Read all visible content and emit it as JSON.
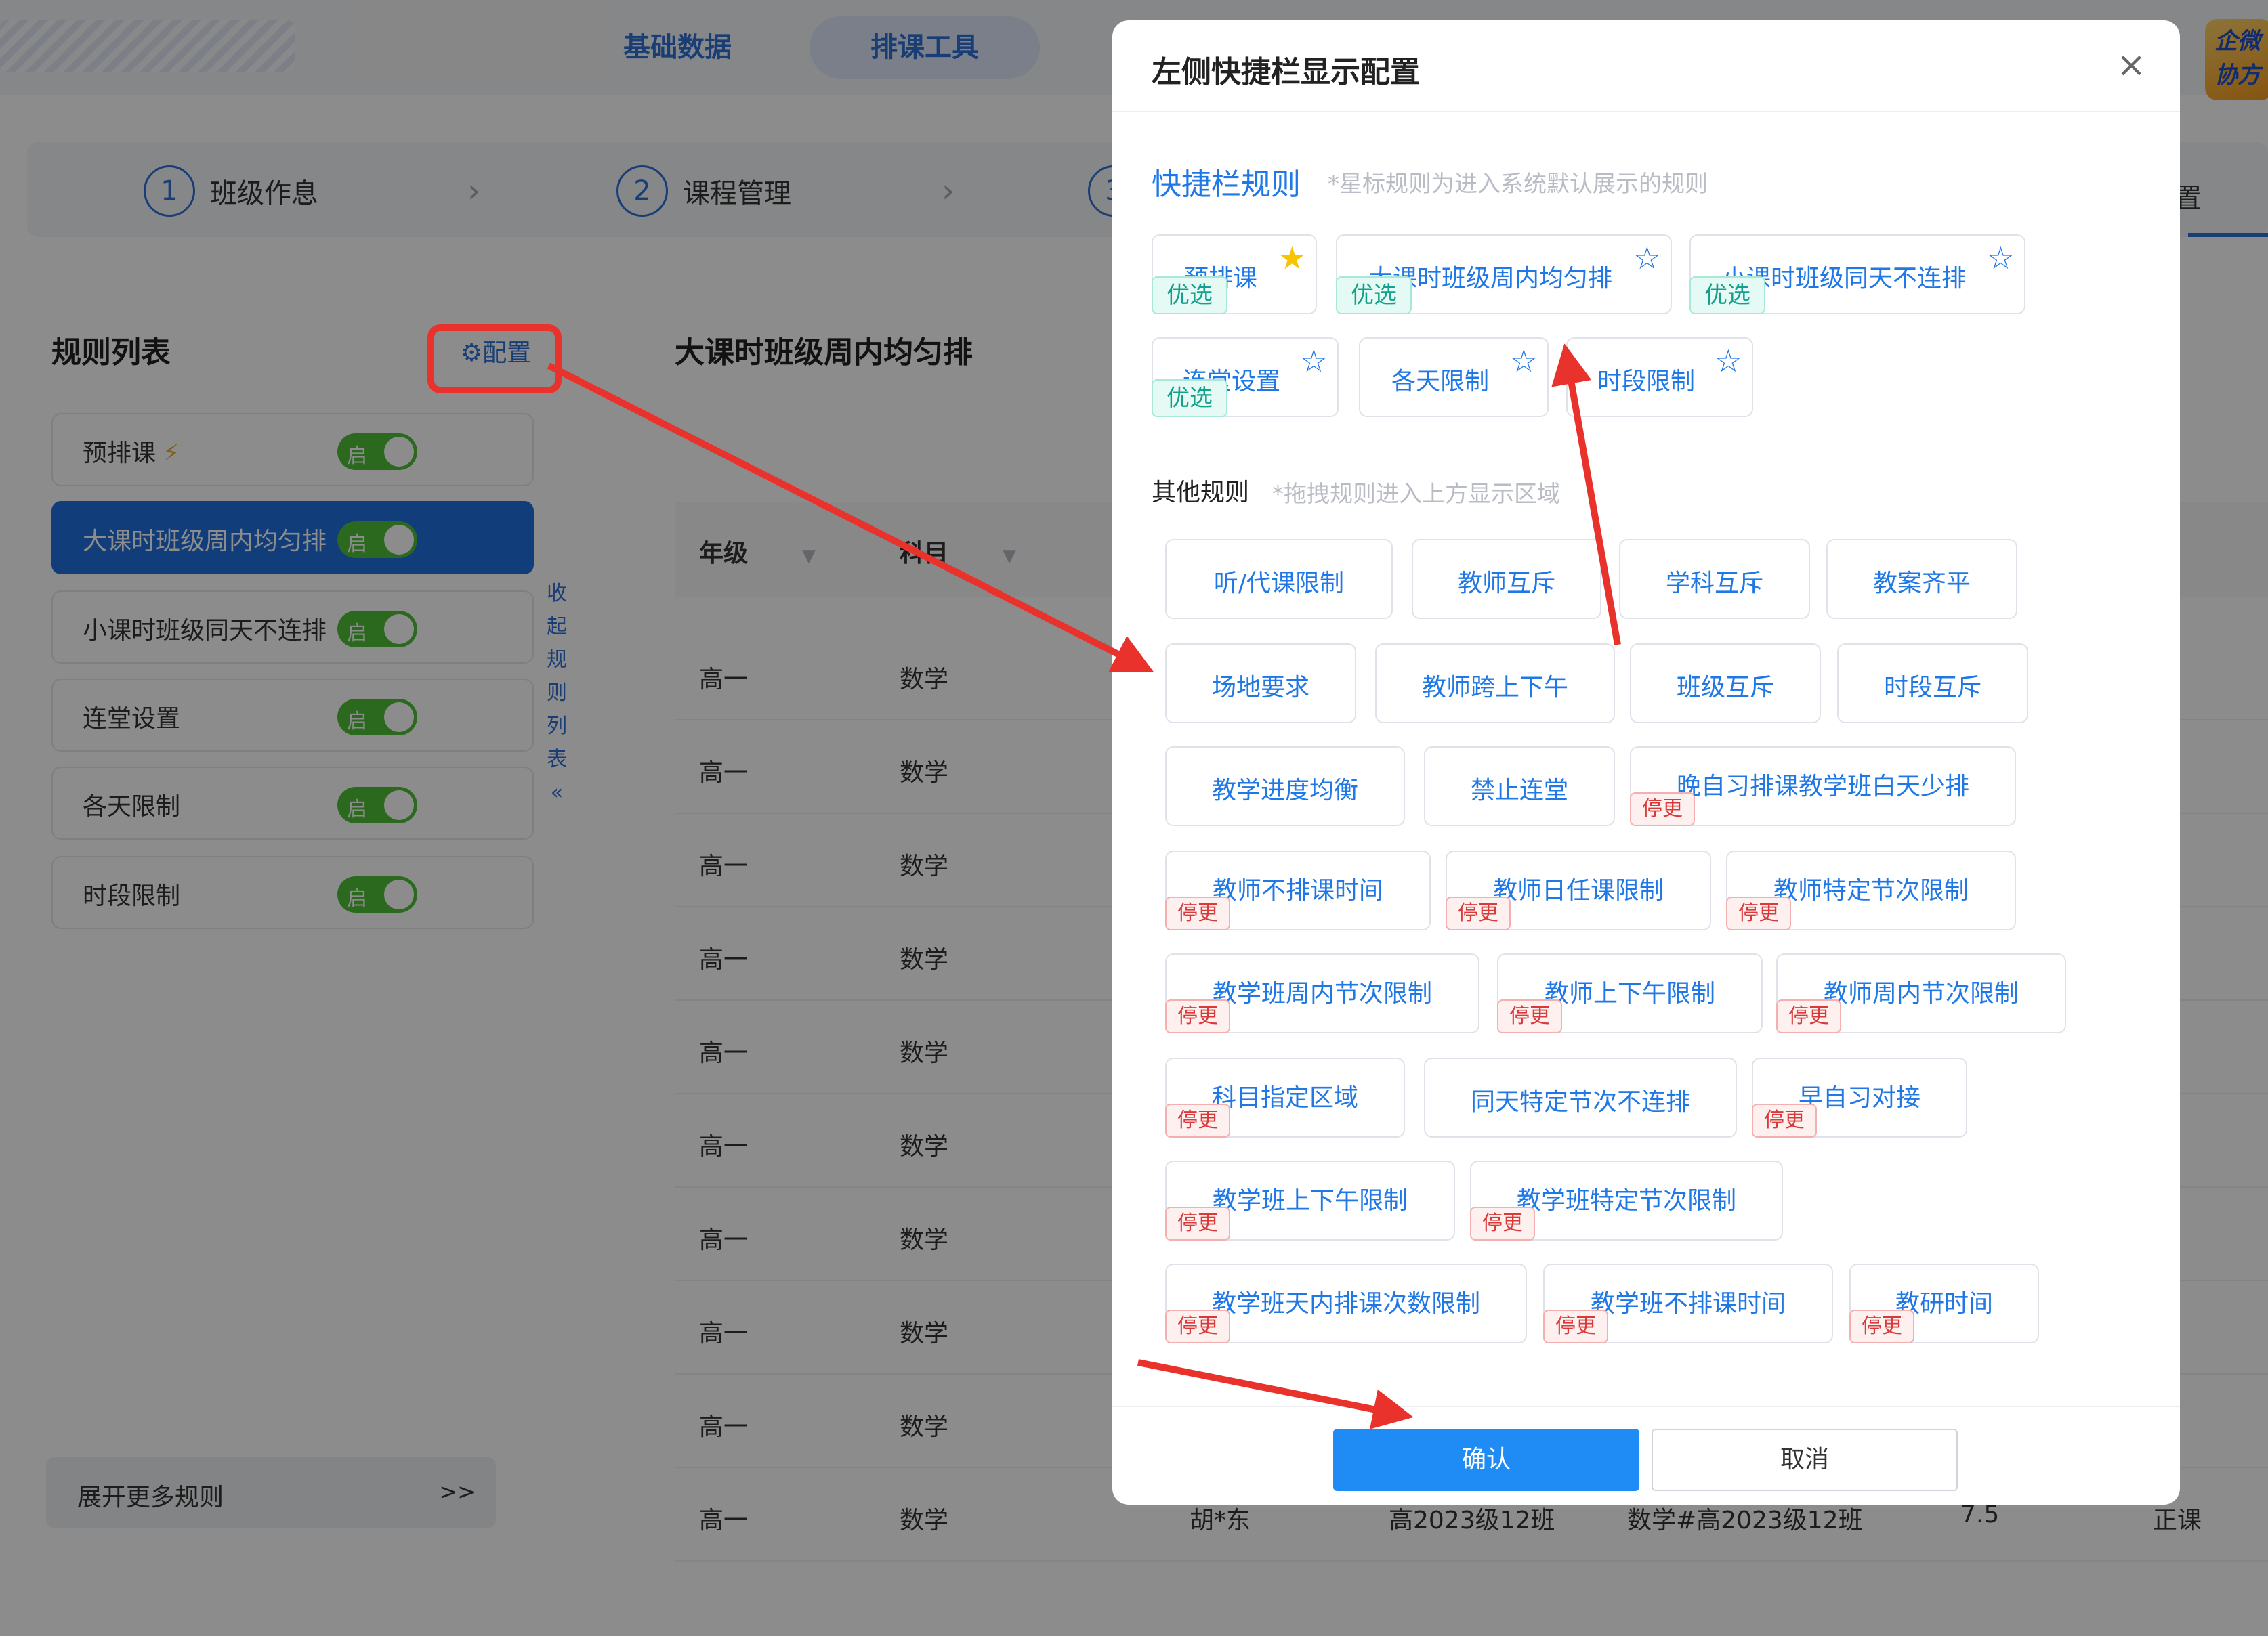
{
  "header": {
    "tabs": [
      {
        "label": "基础数据"
      },
      {
        "label": "排课工具"
      }
    ],
    "brand_logo_text": "企微协方"
  },
  "steps": [
    {
      "num": "1",
      "label": "班级作息"
    },
    {
      "num": "2",
      "label": "课程管理"
    },
    {
      "num": "3",
      "label": ""
    }
  ],
  "steps_right_label": "置",
  "left_panel": {
    "title": "规则列表",
    "config_label": "配置",
    "rules": [
      {
        "label": "预排课",
        "switch": "启",
        "bolt": "⚡"
      },
      {
        "label": "大课时班级周内均匀排",
        "switch": "启",
        "active": true
      },
      {
        "label": "小课时班级同天不连排",
        "switch": "启"
      },
      {
        "label": "连堂设置",
        "switch": "启"
      },
      {
        "label": "各天限制",
        "switch": "启"
      },
      {
        "label": "时段限制",
        "switch": "启"
      }
    ],
    "collapse_text": "收起规则列表",
    "collapse_icon": "«",
    "more_label": "展开更多规则",
    "more_arrow": ">>"
  },
  "main": {
    "title": "大课时班级周内均匀排",
    "columns": [
      "年级",
      "科目"
    ],
    "rows": [
      {
        "grade": "高一",
        "subject": "数学"
      },
      {
        "grade": "高一",
        "subject": "数学"
      },
      {
        "grade": "高一",
        "subject": "数学"
      },
      {
        "grade": "高一",
        "subject": "数学"
      },
      {
        "grade": "高一",
        "subject": "数学"
      },
      {
        "grade": "高一",
        "subject": "数学"
      },
      {
        "grade": "高一",
        "subject": "数学"
      },
      {
        "grade": "高一",
        "subject": "数学"
      },
      {
        "grade": "高一",
        "subject": "数学"
      },
      {
        "grade": "高一",
        "subject": "数学",
        "teacher": "胡*东",
        "class": "高2023级12班",
        "course": "数学#高2023级12班",
        "hours": "7.5",
        "type": "正课"
      }
    ]
  },
  "modal": {
    "title": "左侧快捷栏显示配置",
    "close_icon": "×",
    "quick_title": "快捷栏规则",
    "quick_hint": "*星标规则为进入系统默认展示的规则",
    "quick_rules": [
      {
        "label": "预排课",
        "star": true,
        "tag": "优选"
      },
      {
        "label": "大课时班级周内均匀排",
        "star": false,
        "tag": "优选"
      },
      {
        "label": "小课时班级同天不连排",
        "star": false,
        "tag": "优选"
      },
      {
        "label": "连堂设置",
        "star": false,
        "tag": "优选"
      },
      {
        "label": "各天限制",
        "star": false
      },
      {
        "label": "时段限制",
        "star": false
      }
    ],
    "other_title": "其他规则",
    "other_hint": "*拖拽规则进入上方显示区域",
    "other_rules": [
      {
        "label": "听/代课限制"
      },
      {
        "label": "教师互斥"
      },
      {
        "label": "学科互斥"
      },
      {
        "label": "教案齐平"
      },
      {
        "label": "场地要求"
      },
      {
        "label": "教师跨上下午"
      },
      {
        "label": "班级互斥"
      },
      {
        "label": "时段互斥"
      },
      {
        "label": "教学进度均衡"
      },
      {
        "label": "禁止连堂"
      },
      {
        "label": "晚自习排课教学班白天少排",
        "tag": "停更"
      },
      {
        "label": "教师不排课时间",
        "tag": "停更"
      },
      {
        "label": "教师日任课限制",
        "tag": "停更"
      },
      {
        "label": "教师特定节次限制",
        "tag": "停更"
      },
      {
        "label": "教学班周内节次限制",
        "tag": "停更"
      },
      {
        "label": "教师上下午限制",
        "tag": "停更"
      },
      {
        "label": "教师周内节次限制",
        "tag": "停更"
      },
      {
        "label": "科目指定区域",
        "tag": "停更"
      },
      {
        "label": "同天特定节次不连排"
      },
      {
        "label": "早自习对接",
        "tag": "停更"
      },
      {
        "label": "教学班上下午限制",
        "tag": "停更"
      },
      {
        "label": "教学班特定节次限制",
        "tag": "停更"
      },
      {
        "label": "教学班天内排课次数限制",
        "tag": "停更"
      },
      {
        "label": "教学班不排课时间",
        "tag": "停更"
      },
      {
        "label": "教研时间",
        "tag": "停更"
      }
    ],
    "confirm_label": "确认",
    "cancel_label": "取消"
  },
  "colors": {
    "primary": "#1f78e6",
    "active_rule_bg": "#1f6fde",
    "switch_on": "#4fbf3a",
    "annotation_red": "#e8322b",
    "optimal_tag": "#14a08a",
    "stopped_tag": "#d83a3a",
    "star_on": "#f6c500"
  }
}
